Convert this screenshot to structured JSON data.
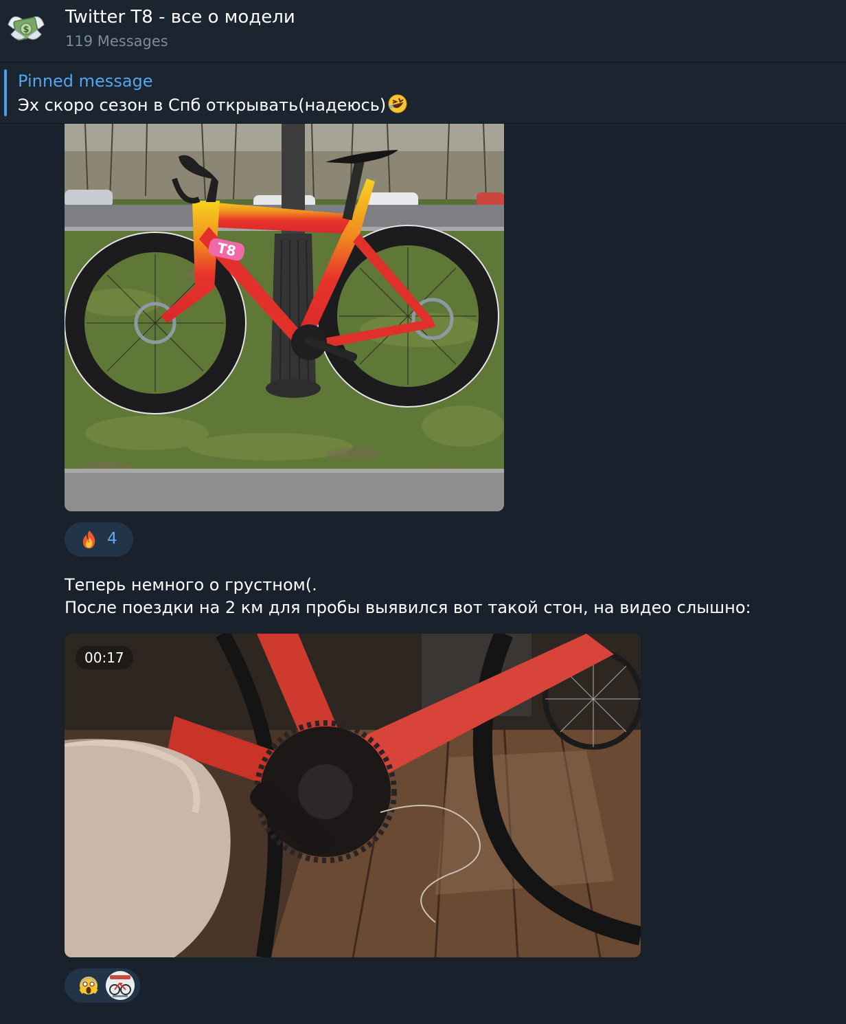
{
  "header": {
    "title": "Twitter T8 - все о модели",
    "subtitle": "119 Messages",
    "avatar_icon": "money-with-wings-icon"
  },
  "pinned": {
    "label": "Pinned message",
    "text": "Эх скоро сезон в Спб открывать(надеюсь)",
    "emoji": "rolling-on-floor-laughing-icon"
  },
  "messages": [
    {
      "type": "photo",
      "image": "red-yellow T8 road bike locked to lamp post on grass",
      "reactions": [
        {
          "icon": "fire-icon",
          "count": "4"
        }
      ]
    },
    {
      "type": "video",
      "lines": [
        "Теперь немного о грустном(.",
        "После поездки на 2 км для пробы выявился вот такой стон, на видео слышно:"
      ],
      "duration": "00:17",
      "reactions": [
        {
          "icon": "screaming-face-icon"
        },
        {
          "icon": "user-avatar-bike-icon"
        }
      ]
    }
  ],
  "colors": {
    "background": "#19212c",
    "header": "#1b2530",
    "accent": "#52a5ee",
    "reaction_bg": "#223447"
  }
}
